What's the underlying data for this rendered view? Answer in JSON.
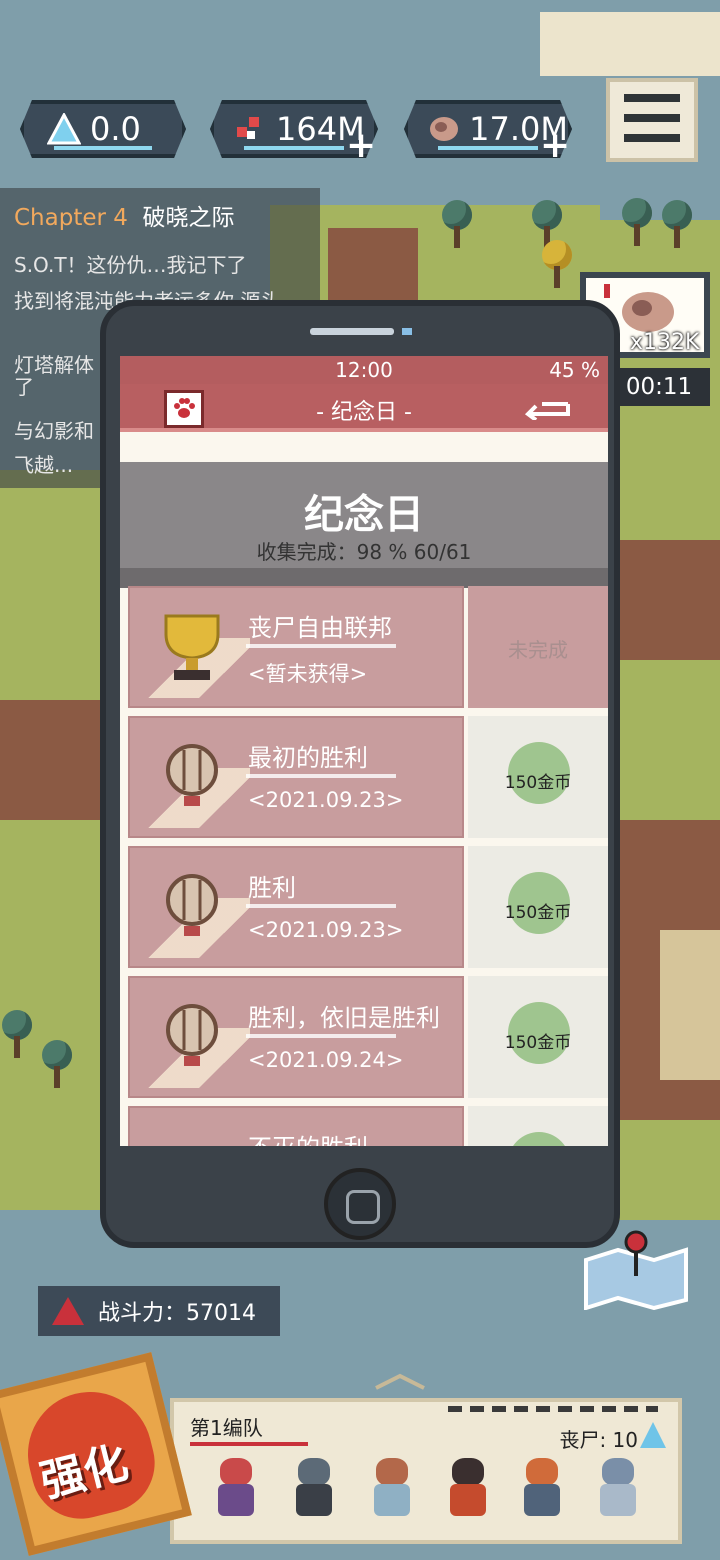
{
  "hud": {
    "crystal": {
      "icon": "crystal-icon",
      "value": "0.0"
    },
    "parts": {
      "icon": "parts-icon",
      "value": "164M"
    },
    "meat": {
      "icon": "meat-icon",
      "value": "17.0M"
    }
  },
  "quest": {
    "chapter_label": "Chapter 4",
    "chapter_name": "破晓之际",
    "items": [
      "S.O.T！这份仇…我记下了",
      "找到将混沌能力者运多你 源头",
      "灯塔解体 了",
      "与幻影和",
      "飞越..."
    ]
  },
  "reward": {
    "count": "x132K",
    "timer": "00:11"
  },
  "power": {
    "label": "战斗力：57014"
  },
  "upgrade": {
    "label": "强化"
  },
  "team": {
    "name": "第1编队",
    "count": "丧尸: 10"
  },
  "phone": {
    "time": "12:00",
    "battery": "45 %",
    "title": "- 纪念日 -",
    "header_title": "纪念日",
    "header_sub": "收集完成：98 %  60/61",
    "cards": [
      {
        "name": "丧尸自由联邦",
        "date": "<暂未获得>",
        "status": "未完成",
        "state": "pending"
      },
      {
        "name": "最初的胜利",
        "date": "<2021.09.23>",
        "status": "150金币",
        "state": "done"
      },
      {
        "name": "胜利",
        "date": "<2021.09.23>",
        "status": "150金币",
        "state": "done"
      },
      {
        "name": "胜利，依旧是胜利",
        "date": "<2021.09.24>",
        "status": "150金币",
        "state": "done"
      },
      {
        "name": "不灭的胜利",
        "date": "",
        "status": "",
        "state": "done"
      }
    ]
  },
  "colors": {
    "accent": "#b85f61",
    "card": "#c89d9e",
    "coin": "#9fc58f"
  }
}
